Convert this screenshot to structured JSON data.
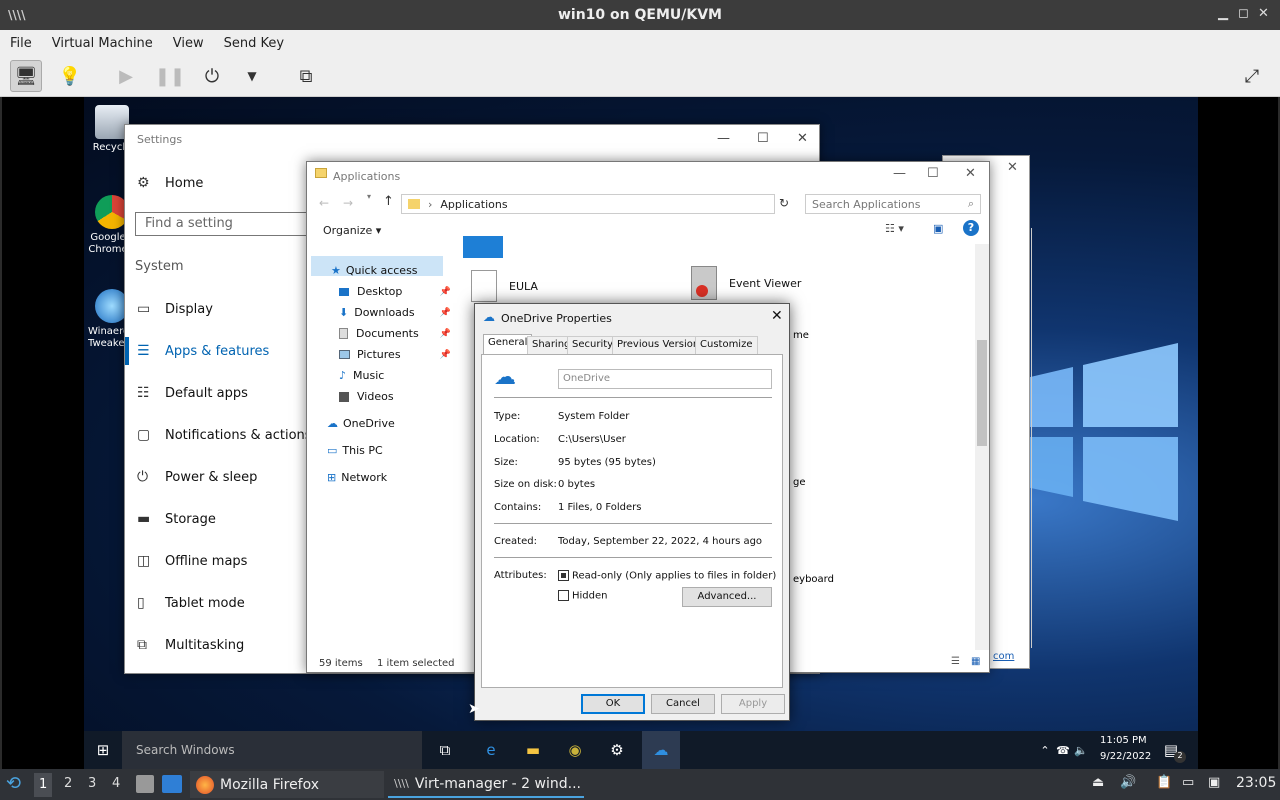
{
  "host": {
    "title": "win10 on QEMU/KVM",
    "menu": [
      "File",
      "Virtual Machine",
      "View",
      "Send Key"
    ]
  },
  "desktop_icons": [
    "Recycle",
    "Google Chrome",
    "Winaero Tweaker"
  ],
  "settings": {
    "title": "Settings",
    "home": "Home",
    "search_placeholder": "Find a setting",
    "section": "System",
    "items": [
      "Display",
      "Apps & features",
      "Default apps",
      "Notifications & actions",
      "Power & sleep",
      "Storage",
      "Offline maps",
      "Tablet mode",
      "Multitasking"
    ]
  },
  "explorer": {
    "title": "Applications",
    "path": "Applications",
    "search_placeholder": "Search Applications",
    "organize": "Organize ▾",
    "nav": [
      "Quick access",
      "Desktop",
      "Downloads",
      "Documents",
      "Pictures",
      "Music",
      "Videos",
      "OneDrive",
      "This PC",
      "Network"
    ],
    "items": [
      "EULA",
      "Event Viewer",
      "me",
      "ge",
      "eyboard"
    ],
    "status_count": "59 items",
    "status_selected": "1 item selected",
    "behind_link": "com"
  },
  "props": {
    "title": "OneDrive Properties",
    "tabs": [
      "General",
      "Sharing",
      "Security",
      "Previous Versions",
      "Customize"
    ],
    "name": "OneDrive",
    "labels": {
      "type": "Type:",
      "location": "Location:",
      "size": "Size:",
      "size_on_disk": "Size on disk:",
      "contains": "Contains:",
      "created": "Created:",
      "attributes": "Attributes:"
    },
    "values": {
      "type": "System Folder",
      "location": "C:\\Users\\User",
      "size": "95 bytes (95 bytes)",
      "size_on_disk": "0 bytes",
      "contains": "1 Files, 0 Folders",
      "created": "Today, September 22, 2022, 4 hours ago"
    },
    "readonly": "Read-only (Only applies to files in folder)",
    "hidden": "Hidden",
    "advanced": "Advanced...",
    "ok": "OK",
    "cancel": "Cancel",
    "apply": "Apply"
  },
  "guest_taskbar": {
    "search": "Search Windows",
    "time": "11:05 PM",
    "date": "9/22/2022",
    "notif_count": "2"
  },
  "host_taskbar": {
    "workspaces": [
      "1",
      "2",
      "3",
      "4"
    ],
    "firefox": "Mozilla Firefox",
    "virtmanager": "Virt-manager - 2 wind...",
    "clock": "23:05"
  }
}
